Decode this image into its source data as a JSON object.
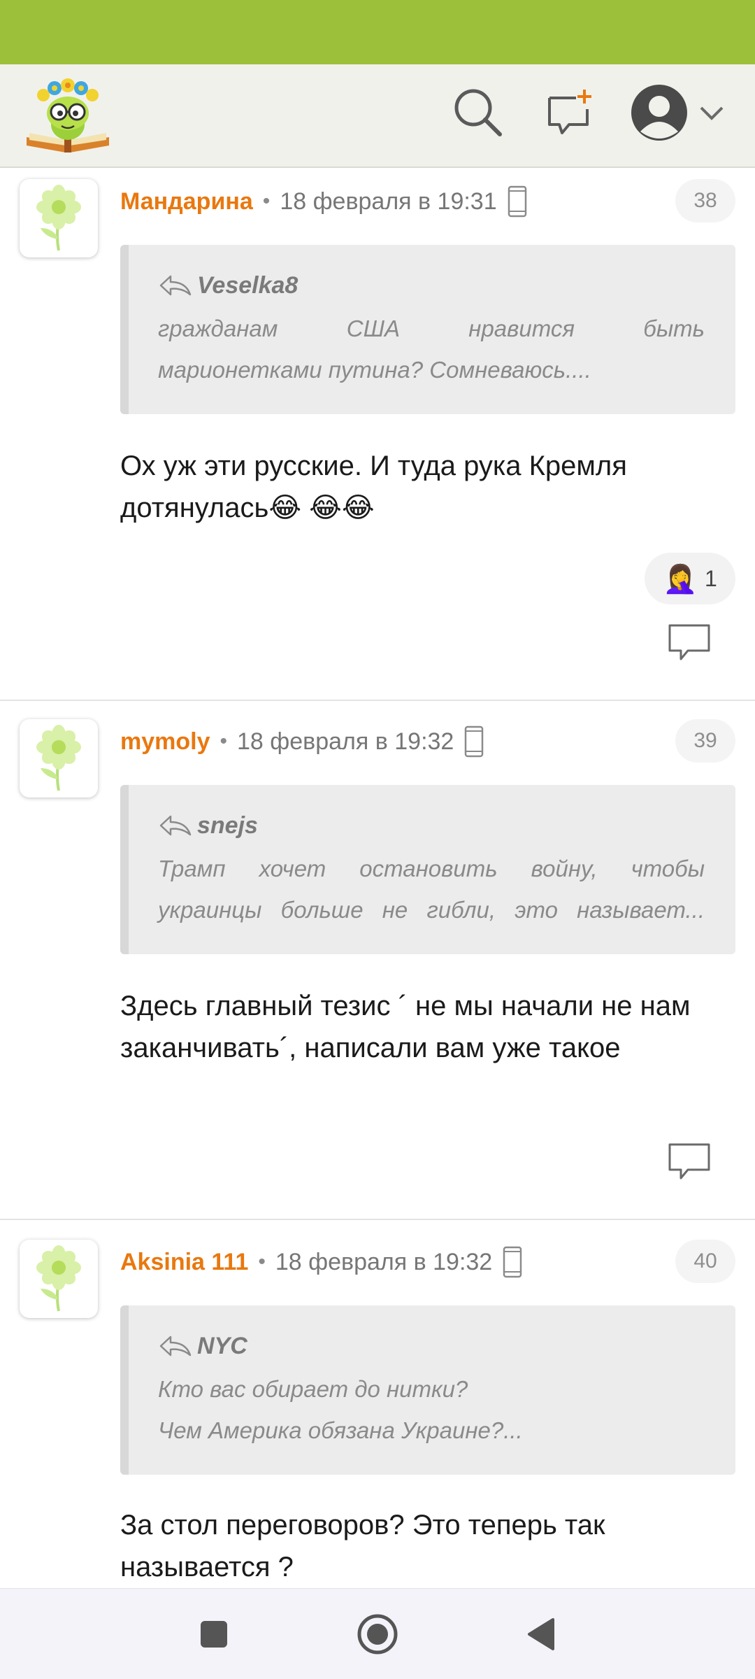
{
  "colors": {
    "status_bar": "#9cc03a",
    "author": "#e9780f",
    "quote_bg": "#ececec"
  },
  "header": {
    "logo_icon": "flower-book-logo",
    "search_icon": "search-icon",
    "new_message_icon": "new-message-icon",
    "profile_icon": "user-avatar-icon"
  },
  "comments": [
    {
      "author": "Мандарина",
      "date": "18 февраля в 19:31",
      "number": "38",
      "quote_author": "Veselka8",
      "quote_lines": [
        "гражданам США нравится быть",
        "марионетками путина? Сомневаюсь...."
      ],
      "body": "Ох уж эти русские. И туда рука Кремля дотянулась😂 😂😂",
      "reaction_emoji": "🤦‍♀️",
      "reaction_count": "1"
    },
    {
      "author": "mymoly",
      "date": "18 февраля в 19:32",
      "number": "39",
      "quote_author": "snejs",
      "quote_lines": [
        "Трамп хочет остановить войну, чтобы",
        "украинцы больше не гибли, это называет..."
      ],
      "body": "Здесь главный тезис ´ не мы начали не нам заканчивать´, написали вам уже такое"
    },
    {
      "author": "Aksinia 111",
      "date": "18 февраля в 19:32",
      "number": "40",
      "quote_author": "NYC",
      "quote_lines": [
        "Кто вас обирает до нитки?",
        "Чем Америка обязана Украине?..."
      ],
      "body": "За стол переговоров? Это теперь так называется ?"
    }
  ],
  "nav": {
    "recents_icon": "square-recents-icon",
    "home_icon": "circle-home-icon",
    "back_icon": "triangle-back-icon"
  }
}
